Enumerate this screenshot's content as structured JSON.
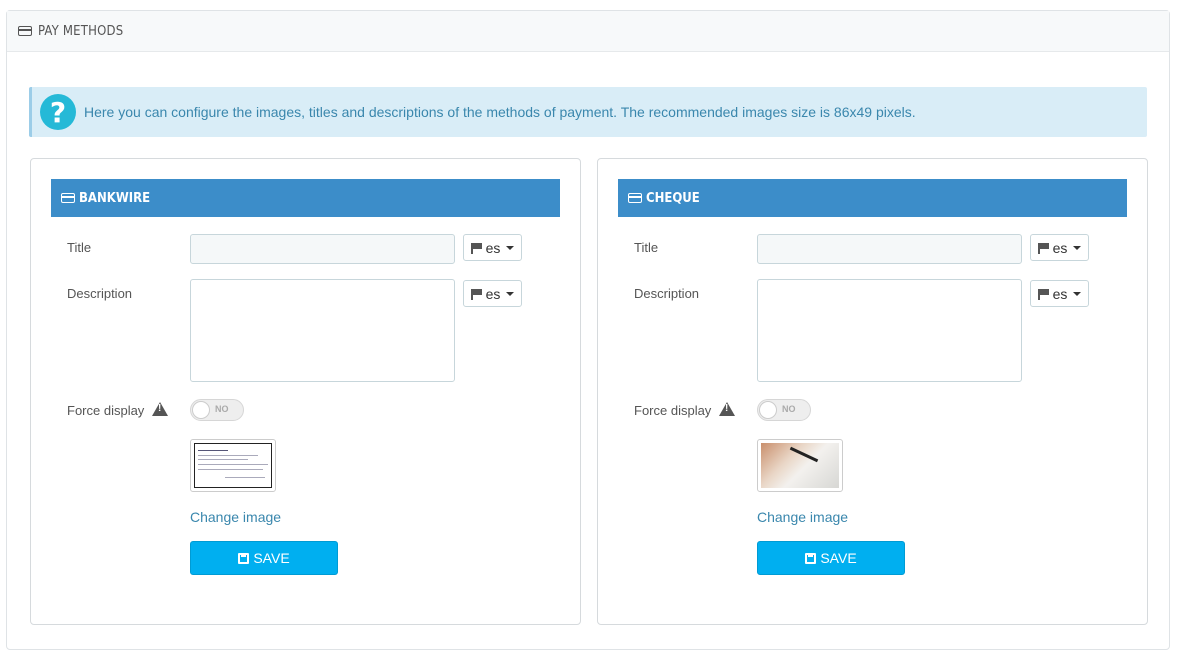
{
  "panel": {
    "title": "PAY METHODS"
  },
  "alert": {
    "text": "Here you can configure the images, titles and descriptions of the methods of payment. The recommended images size is 86x49 pixels."
  },
  "methods": [
    {
      "heading": "BANKWIRE",
      "title_label": "Title",
      "title_value": "",
      "description_label": "Description",
      "description_value": "",
      "lang": "es",
      "force_display_label": "Force display",
      "force_display": "NO",
      "change_image": "Change image",
      "save_label": "SAVE"
    },
    {
      "heading": "CHEQUE",
      "title_label": "Title",
      "title_value": "",
      "description_label": "Description",
      "description_value": "",
      "lang": "es",
      "force_display_label": "Force display",
      "force_display": "NO",
      "change_image": "Change image",
      "save_label": "SAVE"
    }
  ],
  "colors": {
    "accent": "#00aff0",
    "heading_bg": "#3c8dc9",
    "alert_bg": "#d9edf7",
    "alert_text": "#3a87ad"
  }
}
